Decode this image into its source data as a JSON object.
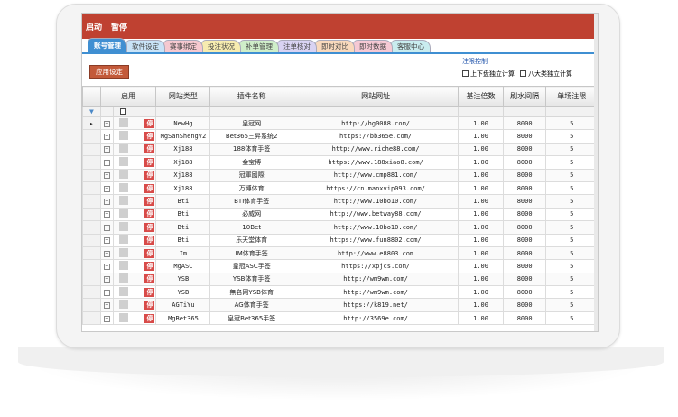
{
  "toolbar": {
    "start_label": "启动",
    "pause_label": "暂停"
  },
  "tabs": [
    "账号管理",
    "软件设定",
    "赛事绑定",
    "投注状况",
    "补单管理",
    "注单核对",
    "即时对比",
    "即时数据",
    "客服中心"
  ],
  "tab_colors": [
    "#3f8fd2",
    "#c9e3f7",
    "#f6c9d0",
    "#f7ecb0",
    "#cfeec9",
    "#d9d3f3",
    "#f9d9bd",
    "#f6c9d4",
    "#c9ecef"
  ],
  "apply_label": "应用设定",
  "limit": {
    "title": "注限控制",
    "opt1": "上下盘独立计算",
    "opt2": "八大类独立计算"
  },
  "columns": {
    "enabled": "启用",
    "site_type": "网站类型",
    "plugin": "插件名称",
    "url": "网站网址",
    "multiplier": "基注倍数",
    "interval": "刷水间隔",
    "limit": "单场注限"
  },
  "stop_label": "停",
  "rows": [
    {
      "type": "NewHg",
      "plugin": "皇冠网",
      "url": "http://hg0088.com/",
      "mult": "1.00",
      "interval": "8000",
      "limit": "5"
    },
    {
      "type": "MgSanShengV2",
      "plugin": "Bet365三昇系统2",
      "url": "https://bb365e.com/",
      "mult": "1.00",
      "interval": "8000",
      "limit": "5"
    },
    {
      "type": "Xj188",
      "plugin": "188体育手签",
      "url": "http://www.riche88.com/",
      "mult": "1.00",
      "interval": "8000",
      "limit": "5"
    },
    {
      "type": "Xj188",
      "plugin": "金宝博",
      "url": "https://www.188xiao8.com/",
      "mult": "1.00",
      "interval": "8000",
      "limit": "5"
    },
    {
      "type": "Xj188",
      "plugin": "冠軍國際",
      "url": "http://www.cmp881.com/",
      "mult": "1.00",
      "interval": "8000",
      "limit": "5"
    },
    {
      "type": "Xj188",
      "plugin": "万博体育",
      "url": "https://cn.manxvip093.com/",
      "mult": "1.00",
      "interval": "8000",
      "limit": "5"
    },
    {
      "type": "Bti",
      "plugin": "BTI体育手签",
      "url": "http://www.10bo10.com/",
      "mult": "1.00",
      "interval": "8000",
      "limit": "5"
    },
    {
      "type": "Bti",
      "plugin": "必威网",
      "url": "http://www.betway88.com/",
      "mult": "1.00",
      "interval": "8000",
      "limit": "5"
    },
    {
      "type": "Bti",
      "plugin": "10Bet",
      "url": "http://www.10bo10.com/",
      "mult": "1.00",
      "interval": "8000",
      "limit": "5"
    },
    {
      "type": "Bti",
      "plugin": "乐天堂体育",
      "url": "https://www.fun8802.com/",
      "mult": "1.00",
      "interval": "8000",
      "limit": "5"
    },
    {
      "type": "Im",
      "plugin": "IM体育手签",
      "url": "http://www.e8803.com",
      "mult": "1.00",
      "interval": "8000",
      "limit": "5"
    },
    {
      "type": "MgASC",
      "plugin": "皇冠ASC手签",
      "url": "https://xpjcs.com/",
      "mult": "1.00",
      "interval": "8000",
      "limit": "5"
    },
    {
      "type": "YSB",
      "plugin": "YSB体育手签",
      "url": "http://wm9wm.com/",
      "mult": "1.00",
      "interval": "8000",
      "limit": "5"
    },
    {
      "type": "YSB",
      "plugin": "無名网YSB体育",
      "url": "http://wm9wm.com/",
      "mult": "1.00",
      "interval": "8000",
      "limit": "5"
    },
    {
      "type": "AGTiYu",
      "plugin": "AG体育手签",
      "url": "https://k819.net/",
      "mult": "1.00",
      "interval": "8000",
      "limit": "5"
    },
    {
      "type": "MgBet365",
      "plugin": "皇冠Bet365手签",
      "url": "http://3569e.com/",
      "mult": "1.00",
      "interval": "8000",
      "limit": "5"
    }
  ]
}
